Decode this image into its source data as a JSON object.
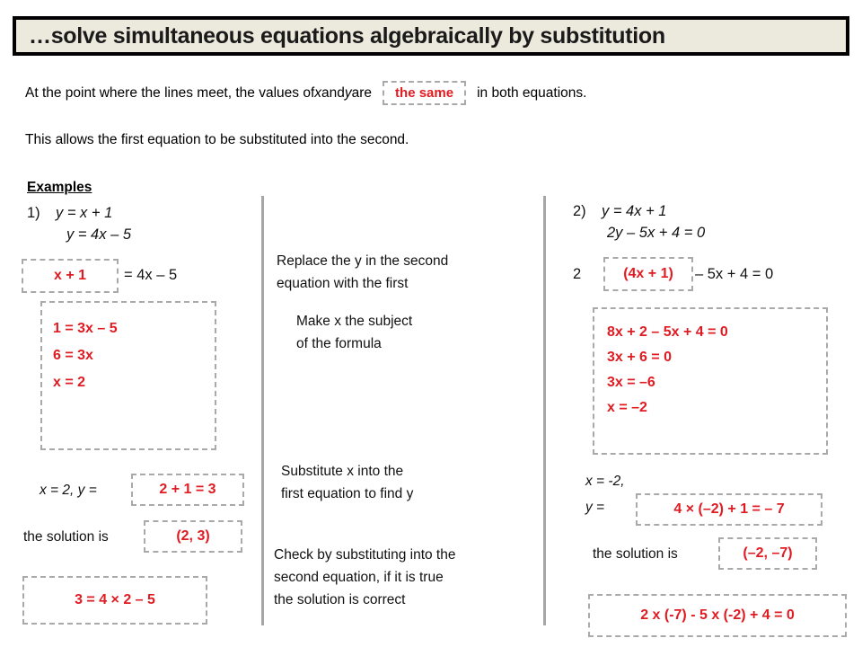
{
  "header": {
    "title": "…solve simultaneous equations algebraically by substitution",
    "bg_color": "#ECE9DD",
    "border_color": "#000000"
  },
  "colors": {
    "red_accent": "#E01B22",
    "dash_gray": "#A9A9A9",
    "divider_gray": "#A6A6A6",
    "text_black": "#111111"
  },
  "intro": {
    "line1_before": "At the point where the lines meet, the values of ",
    "line1_x": "x",
    "line1_and": " and ",
    "line1_y": "y",
    "line1_are": " are",
    "line1_highlight": "the same",
    "line1_after": "in both equations.",
    "line2": "This allows the first equation to be substituted into the second."
  },
  "examples_heading": "Examples",
  "example1": {
    "number": "1)",
    "eq1": "y  =  x + 1",
    "eq2": "y  =  4x – 5",
    "sub_highlight": "x + 1",
    "sub_rest": "=  4x – 5",
    "working": [
      "1  =  3x – 5",
      "6  =  3x",
      "x  =  2"
    ],
    "find_y_label": "x = 2, y  =",
    "find_y_highlight": "2 + 1  =  3",
    "solution_label": "the solution is",
    "solution_highlight": "(2, 3)",
    "check_highlight": "3  =  4 × 2 – 5"
  },
  "example2": {
    "number": "2)",
    "eq1": "y  =  4x + 1",
    "eq2": "2y – 5x + 4  =  0",
    "sub_prefix": "2",
    "sub_highlight": "(4x + 1)",
    "sub_rest": "– 5x + 4  =  0",
    "working": [
      "8x + 2 – 5x + 4  =  0",
      "3x + 6  =  0",
      "3x  =  –6",
      "x  =  –2"
    ],
    "find_x_label": "x = -2,",
    "find_y_label": "y  =",
    "find_y_highlight": "4 × (–2) + 1  =  – 7",
    "solution_label": "the solution is",
    "solution_highlight": "(–2, –7)",
    "check_highlight": "2 x (-7)  - 5 x (-2) + 4 = 0"
  },
  "instructions": {
    "step1_l1": "Replace the y in the second",
    "step1_l2": "equation with the first",
    "step2_l1": "Make x the subject",
    "step2_l2": "of the formula",
    "step3_l1": "Substitute x into the",
    "step3_l2": "first equation to find y",
    "step4_l1": "Check by substituting into the",
    "step4_l2": "second equation, if it is true",
    "step4_l3": "the solution is correct"
  }
}
